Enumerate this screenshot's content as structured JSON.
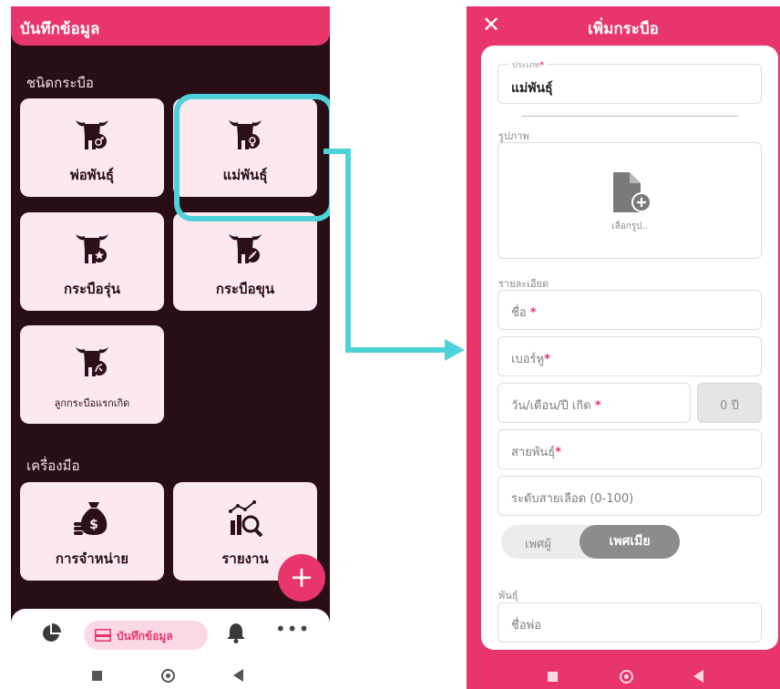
{
  "left": {
    "header_title": "บันทึกข้อมูล",
    "section_types": "ชนิดกระบือ",
    "cards": [
      {
        "label": "พ่อพันธุ์",
        "icon": "bull-male-icon"
      },
      {
        "label": "แม่พันธุ์",
        "icon": "buffalo-female-icon"
      },
      {
        "label": "กระบือรุ่น",
        "icon": "buffalo-star-icon"
      },
      {
        "label": "กระบือขุน",
        "icon": "buffalo-feed-icon"
      },
      {
        "label": "ลูกกระบือแรกเกิด",
        "icon": "buffalo-baby-icon"
      }
    ],
    "section_tools": "เครื่องมือ",
    "tools": [
      {
        "label": "การจำหน่าย",
        "icon": "money-bag-icon"
      },
      {
        "label": "รายงาน",
        "icon": "report-icon"
      }
    ],
    "fab_label": "+",
    "nav": {
      "active_label": "บันทึกข้อมูล",
      "more": "•••"
    }
  },
  "right": {
    "close": "✕",
    "title": "เพิ่มกระบือ",
    "type_legend": "ประเภท",
    "type_value": "แม่พันธุ์",
    "required_mark": "*",
    "image_label": "รูปภาพ",
    "image_caption": "เลือกรูป..",
    "details_label": "รายละเอียด",
    "name_placeholder": "ชื่อ",
    "ear_placeholder": "เบอร์หู",
    "birth_placeholder": "วัน/เดือน/ปี เกิด",
    "age_value": "0 ปี",
    "breed_placeholder": "สายพันธุ์",
    "blood_placeholder": "ระดับสายเลือด (0-100)",
    "gender_male": "เพศผู้",
    "gender_female": "เพศเมีย",
    "lineage_label": "พันธุ์",
    "father_placeholder": "ชื่อพ่อ"
  },
  "colors": {
    "accent": "#e8356c",
    "dark_bg": "#2a0e16",
    "card_bg": "#fbe9ef",
    "highlight": "#4fd1d9"
  }
}
